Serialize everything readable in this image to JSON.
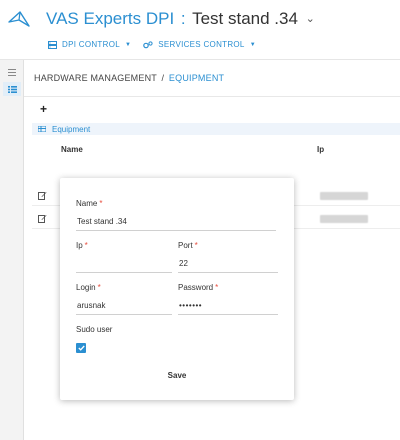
{
  "header": {
    "product": "VAS Experts DPI",
    "separator": ":",
    "stand": "Test stand .34",
    "stand_caret": "⌄",
    "nav": [
      {
        "label": "DPI CONTROL",
        "icon": "server-icon"
      },
      {
        "label": "SERVICES CONTROL",
        "icon": "gears-icon"
      }
    ]
  },
  "rail": {
    "items": [
      "menu-icon",
      "list-icon"
    ]
  },
  "breadcrumb": {
    "section": "HARDWARE MANAGEMENT",
    "separator": "/",
    "current": "EQUIPMENT"
  },
  "toolbar": {
    "add_label": "+"
  },
  "panel": {
    "title": "Equipment",
    "icon": "list-icon"
  },
  "table": {
    "columns": [
      "Name",
      "Ip"
    ],
    "rows": [
      {
        "name": "",
        "ip": ""
      },
      {
        "name": "",
        "ip": ""
      }
    ]
  },
  "modal": {
    "name_label": "Name",
    "name_value": "Test stand .34",
    "ip_label": "Ip",
    "ip_value": "",
    "port_label": "Port",
    "port_value": "22",
    "login_label": "Login",
    "login_value": "arusnak",
    "password_label": "Password",
    "password_value": "•••••••",
    "sudo_label": "Sudo user",
    "sudo_checked": true,
    "required_mark": "*",
    "save_label": "Save"
  },
  "colors": {
    "accent": "#2b8fd1",
    "required": "#e74c3c",
    "panel_bg": "#eef4fb",
    "rail_bg": "#f3f3f3"
  }
}
